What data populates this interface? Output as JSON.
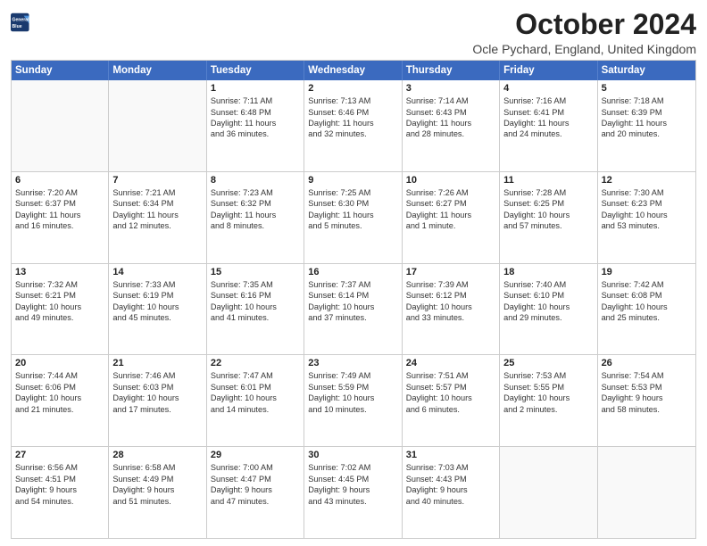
{
  "logo": {
    "line1": "General",
    "line2": "Blue"
  },
  "title": "October 2024",
  "location": "Ocle Pychard, England, United Kingdom",
  "days_of_week": [
    "Sunday",
    "Monday",
    "Tuesday",
    "Wednesday",
    "Thursday",
    "Friday",
    "Saturday"
  ],
  "weeks": [
    [
      {
        "day": "",
        "info": [],
        "empty": true
      },
      {
        "day": "",
        "info": [],
        "empty": true
      },
      {
        "day": "1",
        "info": [
          "Sunrise: 7:11 AM",
          "Sunset: 6:48 PM",
          "Daylight: 11 hours",
          "and 36 minutes."
        ]
      },
      {
        "day": "2",
        "info": [
          "Sunrise: 7:13 AM",
          "Sunset: 6:46 PM",
          "Daylight: 11 hours",
          "and 32 minutes."
        ]
      },
      {
        "day": "3",
        "info": [
          "Sunrise: 7:14 AM",
          "Sunset: 6:43 PM",
          "Daylight: 11 hours",
          "and 28 minutes."
        ]
      },
      {
        "day": "4",
        "info": [
          "Sunrise: 7:16 AM",
          "Sunset: 6:41 PM",
          "Daylight: 11 hours",
          "and 24 minutes."
        ]
      },
      {
        "day": "5",
        "info": [
          "Sunrise: 7:18 AM",
          "Sunset: 6:39 PM",
          "Daylight: 11 hours",
          "and 20 minutes."
        ]
      }
    ],
    [
      {
        "day": "6",
        "info": [
          "Sunrise: 7:20 AM",
          "Sunset: 6:37 PM",
          "Daylight: 11 hours",
          "and 16 minutes."
        ]
      },
      {
        "day": "7",
        "info": [
          "Sunrise: 7:21 AM",
          "Sunset: 6:34 PM",
          "Daylight: 11 hours",
          "and 12 minutes."
        ]
      },
      {
        "day": "8",
        "info": [
          "Sunrise: 7:23 AM",
          "Sunset: 6:32 PM",
          "Daylight: 11 hours",
          "and 8 minutes."
        ]
      },
      {
        "day": "9",
        "info": [
          "Sunrise: 7:25 AM",
          "Sunset: 6:30 PM",
          "Daylight: 11 hours",
          "and 5 minutes."
        ]
      },
      {
        "day": "10",
        "info": [
          "Sunrise: 7:26 AM",
          "Sunset: 6:27 PM",
          "Daylight: 11 hours",
          "and 1 minute."
        ]
      },
      {
        "day": "11",
        "info": [
          "Sunrise: 7:28 AM",
          "Sunset: 6:25 PM",
          "Daylight: 10 hours",
          "and 57 minutes."
        ]
      },
      {
        "day": "12",
        "info": [
          "Sunrise: 7:30 AM",
          "Sunset: 6:23 PM",
          "Daylight: 10 hours",
          "and 53 minutes."
        ]
      }
    ],
    [
      {
        "day": "13",
        "info": [
          "Sunrise: 7:32 AM",
          "Sunset: 6:21 PM",
          "Daylight: 10 hours",
          "and 49 minutes."
        ]
      },
      {
        "day": "14",
        "info": [
          "Sunrise: 7:33 AM",
          "Sunset: 6:19 PM",
          "Daylight: 10 hours",
          "and 45 minutes."
        ]
      },
      {
        "day": "15",
        "info": [
          "Sunrise: 7:35 AM",
          "Sunset: 6:16 PM",
          "Daylight: 10 hours",
          "and 41 minutes."
        ]
      },
      {
        "day": "16",
        "info": [
          "Sunrise: 7:37 AM",
          "Sunset: 6:14 PM",
          "Daylight: 10 hours",
          "and 37 minutes."
        ]
      },
      {
        "day": "17",
        "info": [
          "Sunrise: 7:39 AM",
          "Sunset: 6:12 PM",
          "Daylight: 10 hours",
          "and 33 minutes."
        ]
      },
      {
        "day": "18",
        "info": [
          "Sunrise: 7:40 AM",
          "Sunset: 6:10 PM",
          "Daylight: 10 hours",
          "and 29 minutes."
        ]
      },
      {
        "day": "19",
        "info": [
          "Sunrise: 7:42 AM",
          "Sunset: 6:08 PM",
          "Daylight: 10 hours",
          "and 25 minutes."
        ]
      }
    ],
    [
      {
        "day": "20",
        "info": [
          "Sunrise: 7:44 AM",
          "Sunset: 6:06 PM",
          "Daylight: 10 hours",
          "and 21 minutes."
        ]
      },
      {
        "day": "21",
        "info": [
          "Sunrise: 7:46 AM",
          "Sunset: 6:03 PM",
          "Daylight: 10 hours",
          "and 17 minutes."
        ]
      },
      {
        "day": "22",
        "info": [
          "Sunrise: 7:47 AM",
          "Sunset: 6:01 PM",
          "Daylight: 10 hours",
          "and 14 minutes."
        ]
      },
      {
        "day": "23",
        "info": [
          "Sunrise: 7:49 AM",
          "Sunset: 5:59 PM",
          "Daylight: 10 hours",
          "and 10 minutes."
        ]
      },
      {
        "day": "24",
        "info": [
          "Sunrise: 7:51 AM",
          "Sunset: 5:57 PM",
          "Daylight: 10 hours",
          "and 6 minutes."
        ]
      },
      {
        "day": "25",
        "info": [
          "Sunrise: 7:53 AM",
          "Sunset: 5:55 PM",
          "Daylight: 10 hours",
          "and 2 minutes."
        ]
      },
      {
        "day": "26",
        "info": [
          "Sunrise: 7:54 AM",
          "Sunset: 5:53 PM",
          "Daylight: 9 hours",
          "and 58 minutes."
        ]
      }
    ],
    [
      {
        "day": "27",
        "info": [
          "Sunrise: 6:56 AM",
          "Sunset: 4:51 PM",
          "Daylight: 9 hours",
          "and 54 minutes."
        ]
      },
      {
        "day": "28",
        "info": [
          "Sunrise: 6:58 AM",
          "Sunset: 4:49 PM",
          "Daylight: 9 hours",
          "and 51 minutes."
        ]
      },
      {
        "day": "29",
        "info": [
          "Sunrise: 7:00 AM",
          "Sunset: 4:47 PM",
          "Daylight: 9 hours",
          "and 47 minutes."
        ]
      },
      {
        "day": "30",
        "info": [
          "Sunrise: 7:02 AM",
          "Sunset: 4:45 PM",
          "Daylight: 9 hours",
          "and 43 minutes."
        ]
      },
      {
        "day": "31",
        "info": [
          "Sunrise: 7:03 AM",
          "Sunset: 4:43 PM",
          "Daylight: 9 hours",
          "and 40 minutes."
        ]
      },
      {
        "day": "",
        "info": [],
        "empty": true
      },
      {
        "day": "",
        "info": [],
        "empty": true
      }
    ]
  ]
}
